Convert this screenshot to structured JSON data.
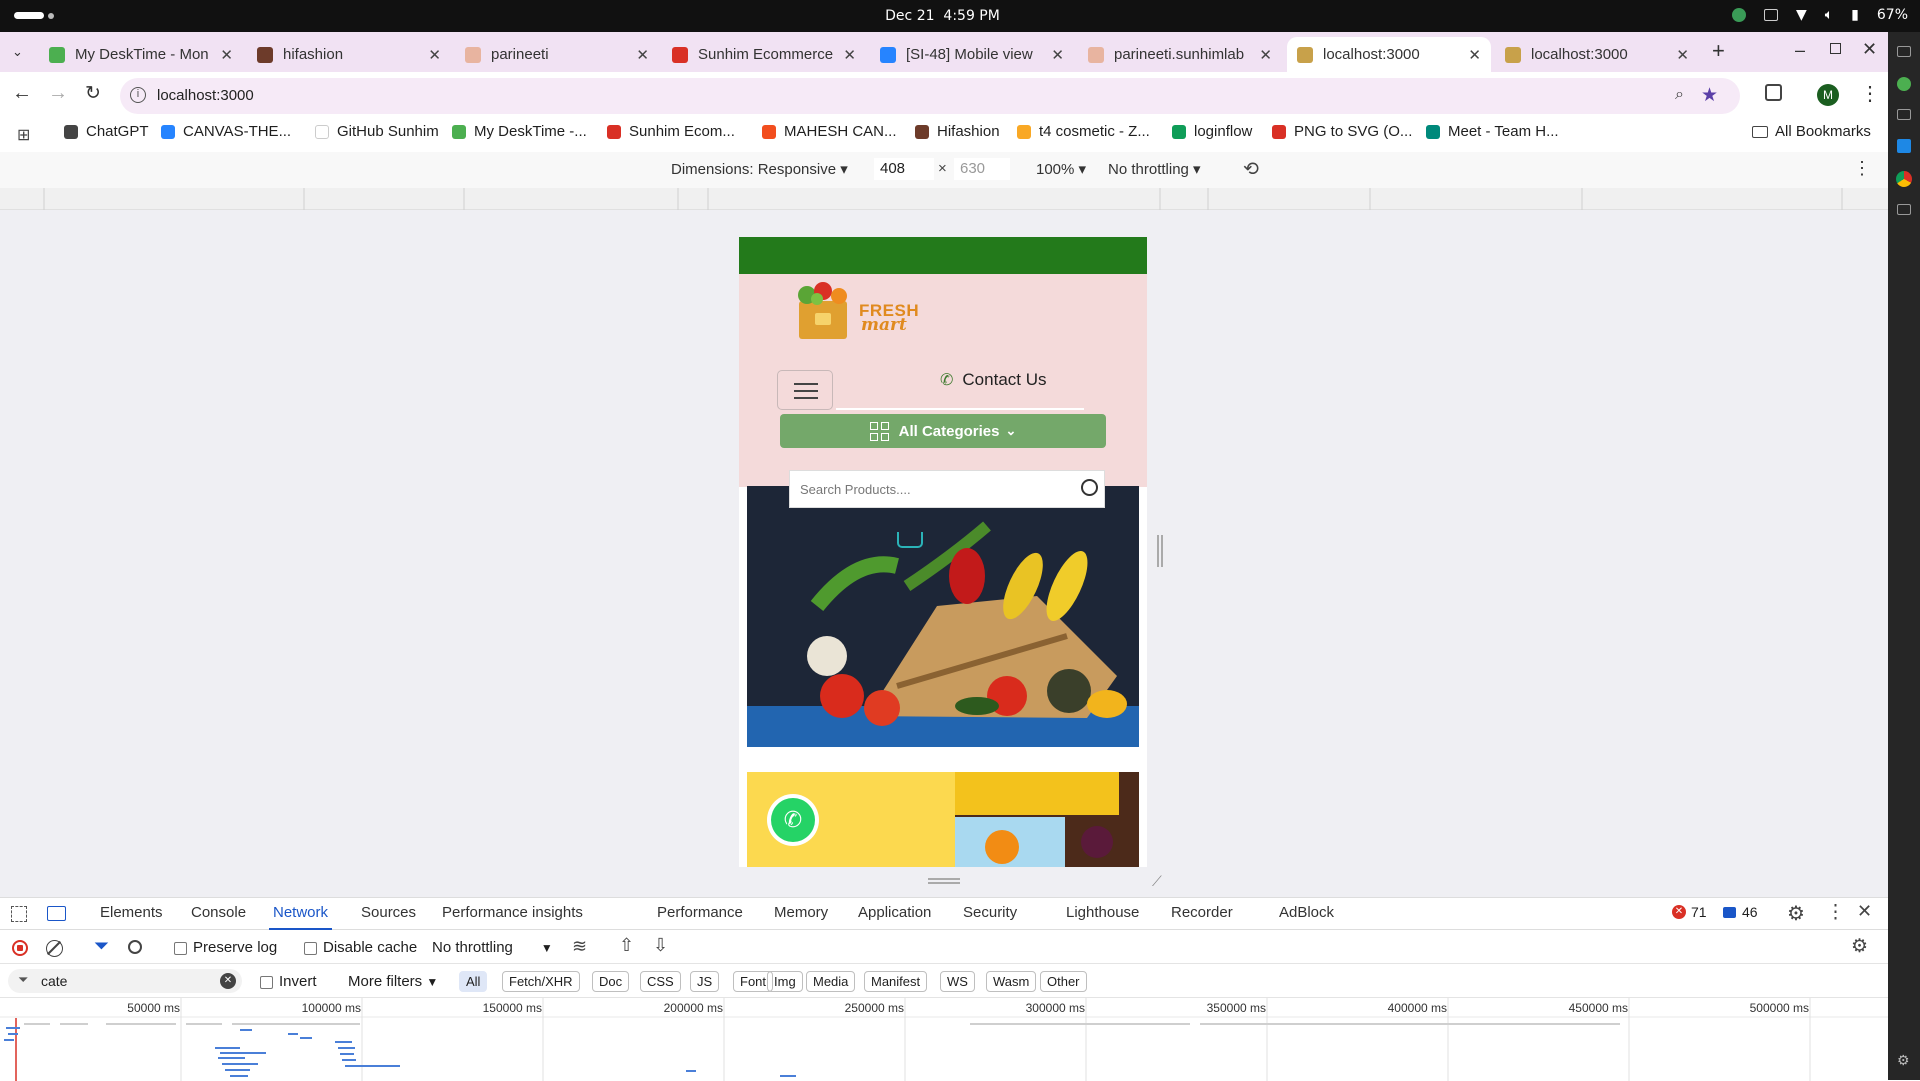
{
  "os": {
    "date": "Dec 21",
    "time": "4:59 PM",
    "battery": "67%"
  },
  "tabs": [
    {
      "title": "My DeskTime - Mon",
      "color": "#4caf50"
    },
    {
      "title": "hifashion",
      "color": "#6d3b2a"
    },
    {
      "title": "parineeti",
      "color": "#e8b4a0"
    },
    {
      "title": "Sunhim Ecommerce",
      "color": "#d93025"
    },
    {
      "title": "[SI-48] Mobile view",
      "color": "#2684ff"
    },
    {
      "title": "parineeti.sunhimlab",
      "color": "#e8b4a0"
    },
    {
      "title": "localhost:3000",
      "color": "#c8a14a"
    },
    {
      "title": "localhost:3000",
      "color": "#c8a14a"
    }
  ],
  "address": {
    "url": "localhost:3000",
    "profile_initial": "M"
  },
  "bookmarks": [
    {
      "label": "ChatGPT",
      "color": "#444"
    },
    {
      "label": "CANVAS-THE...",
      "color": "#2684ff"
    },
    {
      "label": "GitHub Sunhim",
      "color": "#fff"
    },
    {
      "label": "My DeskTime -...",
      "color": "#4caf50"
    },
    {
      "label": "Sunhim Ecom...",
      "color": "#d93025"
    },
    {
      "label": "MAHESH CAN...",
      "color": "#f24e1e"
    },
    {
      "label": "Hifashion",
      "color": "#6d3b2a"
    },
    {
      "label": "t4 cosmetic - Z...",
      "color": "#f9a825"
    },
    {
      "label": "loginflow",
      "color": "#0f9d58"
    },
    {
      "label": "PNG to SVG (O...",
      "color": "#d93025"
    },
    {
      "label": "Meet - Team H...",
      "color": "#00897b"
    }
  ],
  "all_bookmarks": "All Bookmarks",
  "device": {
    "dimensions_label": "Dimensions: Responsive",
    "width": "408",
    "height": "630",
    "zoom": "100%",
    "throttle": "No throttling"
  },
  "site": {
    "brand_top": "FRESH",
    "brand_bottom": "mart",
    "contact": "Contact Us",
    "categories": "All Categories",
    "search_placeholder": "Search Products...."
  },
  "devtools": {
    "tabs": [
      "Elements",
      "Console",
      "Network",
      "Sources",
      "Performance insights",
      "Performance",
      "Memory",
      "Application",
      "Security",
      "Lighthouse",
      "Recorder",
      "AdBlock"
    ],
    "active_tab": "Network",
    "errors": "71",
    "messages": "46",
    "preserve_log": "Preserve log",
    "disable_cache": "Disable cache",
    "throttling": "No throttling",
    "filter_value": "cate",
    "invert": "Invert",
    "more_filters": "More filters",
    "type_filters": [
      "All",
      "Fetch/XHR",
      "Doc",
      "CSS",
      "JS",
      "Font",
      "Img",
      "Media",
      "Manifest",
      "WS",
      "Wasm",
      "Other"
    ],
    "timeline_ticks": [
      "50000 ms",
      "100000 ms",
      "150000 ms",
      "200000 ms",
      "250000 ms",
      "300000 ms",
      "350000 ms",
      "400000 ms",
      "450000 ms",
      "500000 ms"
    ]
  }
}
